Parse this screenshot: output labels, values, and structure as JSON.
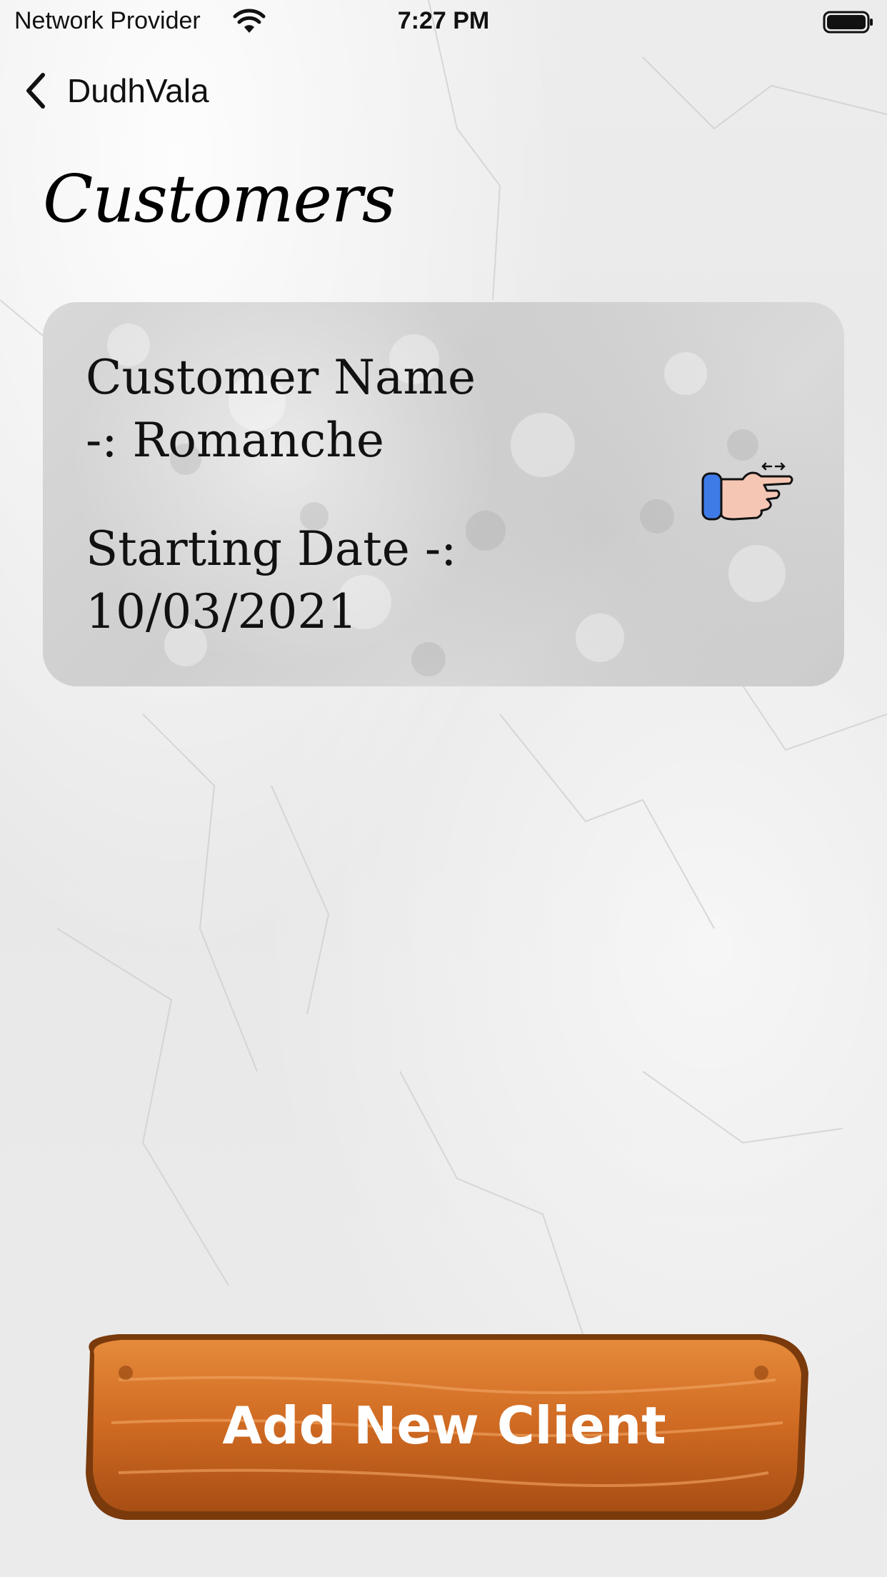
{
  "status_bar": {
    "carrier": "Network Provider",
    "time": "7:27 PM"
  },
  "nav": {
    "back_label": "DudhVala"
  },
  "page": {
    "title": "Customers"
  },
  "customers": [
    {
      "name_line1": "Customer Name",
      "name_line2": "-: Romanche",
      "date_line1": "Starting Date -:",
      "date_line2": "10/03/2021"
    }
  ],
  "actions": {
    "add_client_label": "Add New Client"
  },
  "icons": {
    "back": "chevron-left-icon",
    "swipe": "swipe-hand-icon",
    "wifi": "wifi-icon",
    "battery": "battery-icon"
  },
  "colors": {
    "button_wood": "#c9641e",
    "swipe_cuff": "#3e7be8",
    "hand_skin": "#f6c6b4"
  }
}
